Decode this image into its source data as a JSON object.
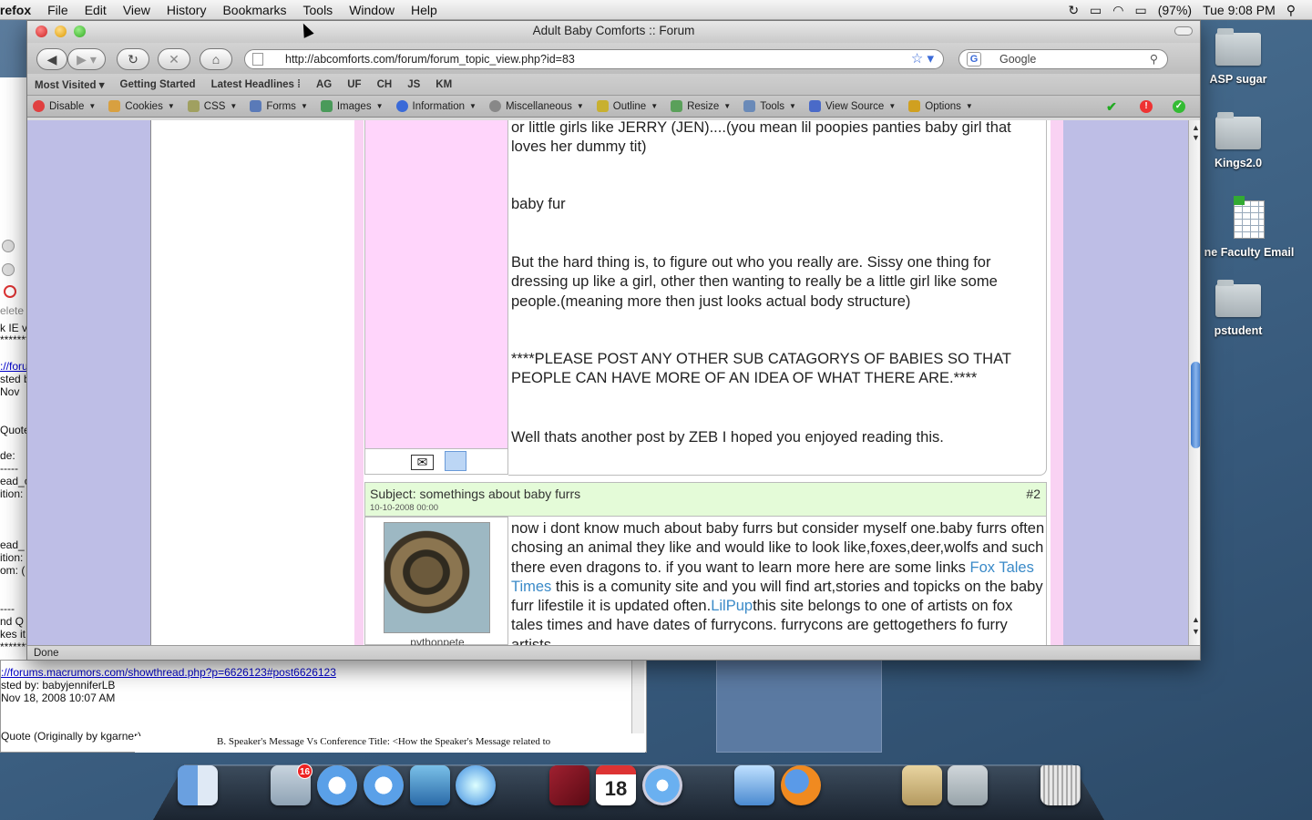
{
  "menubar": {
    "app": "irefox",
    "items": [
      "File",
      "Edit",
      "View",
      "History",
      "Bookmarks",
      "Tools",
      "Window",
      "Help"
    ],
    "battery": "(97%)",
    "clock": "Tue 9:08 PM"
  },
  "desktop_icons": [
    {
      "label": "ASP sugar",
      "icon": "folder-icon"
    },
    {
      "label": "Kings2.0",
      "icon": "folder-icon"
    },
    {
      "label": "ne Faculty Email",
      "icon": "spreadsheet-icon"
    },
    {
      "label": "pstudent",
      "icon": "folder-icon"
    }
  ],
  "window": {
    "title": "Adult Baby Comforts :: Forum",
    "url": "http://abcomforts.com/forum/forum_topic_view.php?id=83",
    "search_placeholder": "Google",
    "status": "Done"
  },
  "bookmarks": [
    "Most Visited ▾",
    "Getting Started",
    "Latest Headlines ⁞",
    "AG",
    "UF",
    "CH",
    "JS",
    "KM"
  ],
  "devbar": [
    {
      "label": "Disable",
      "color": "#e04040"
    },
    {
      "label": "Cookies",
      "color": "#d8a040"
    },
    {
      "label": "CSS",
      "color": "#a0a060"
    },
    {
      "label": "Forms",
      "color": "#5a7ab8"
    },
    {
      "label": "Images",
      "color": "#4a9a5a"
    },
    {
      "label": "Information",
      "color": "#3a6ad8"
    },
    {
      "label": "Miscellaneous",
      "color": "#888888"
    },
    {
      "label": "Outline",
      "color": "#c8b030"
    },
    {
      "label": "Resize",
      "color": "#5aa05a"
    },
    {
      "label": "Tools",
      "color": "#6a8ab8"
    },
    {
      "label": "View Source",
      "color": "#4a6ac8"
    },
    {
      "label": "Options",
      "color": "#d0a020"
    }
  ],
  "post1": {
    "para1": "or little girls like JERRY (JEN)....(you mean lil poopies panties baby girl that loves her dummy tit)",
    "para2": "baby fur",
    "para3": "But the hard thing is, to figure out who you really are. Sissy one thing for dressing up like a girl, other then wanting to really be a little girl like some people.(meaning more then just looks actual body structure)",
    "para4": "****PLEASE POST ANY OTHER SUB CATAGORYS OF BABIES SO THAT PEOPLE CAN HAVE MORE OF AN IDEA OF WHAT THERE ARE.****",
    "para5": "Well thats another post by ZEB I hoped you enjoyed reading this."
  },
  "post2": {
    "subject": "Subject: somethings about baby furrs",
    "date": "10-10-2008 00:00",
    "number": "#2",
    "author": "pythonpete",
    "text_a": "now i dont know much about baby furrs but consider myself one.baby furrs often chosing an animal they like and would like to look like,foxes,deer,wolfs and such there even dragons to. if you want to learn more here are some links ",
    "link1": "Fox Tales Times",
    "text_b": " this is a comunity site and you will find art,stories and topicks on the baby furr lifestile it is updated often.",
    "link2": "LilPup",
    "text_c": "this site belongs to one of artists on fox tales times and have dates of furrycons. furrycons are gettogethers fo furry artists"
  },
  "bg_left": {
    "lines": [
      "elete",
      "k IE v",
      "*******",
      "://foru",
      "sted b",
      " Nov",
      "Quote",
      "de:",
      "-----",
      "ead_c",
      "ition:",
      "ead_",
      "ition:",
      "om: (",
      "----",
      "nd Q",
      "kes it",
      "*******"
    ]
  },
  "bg_bottom": {
    "link": "://forums.macrumors.com/showthread.php?p=6626123#post6626123",
    "posted_by": "sted by: babyjenniferLB",
    "date": " Nov 18, 2008 10:07 AM",
    "quote": "Quote (Originally by kgarner)---"
  },
  "bg_doc": {
    "text": "B.  Speaker's Message Vs Conference Title: <How the Speaker's Message related to"
  },
  "dock": {
    "mail_badge": "16",
    "calendar_day": "18"
  }
}
